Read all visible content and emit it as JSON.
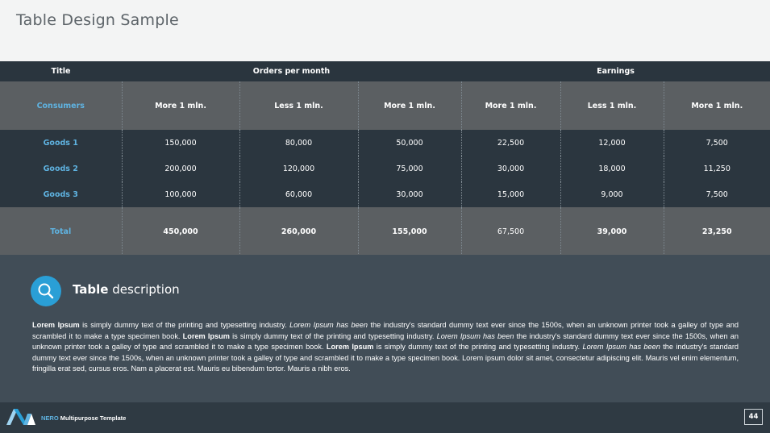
{
  "page": {
    "title": "Table Design Sample",
    "number": "44"
  },
  "table": {
    "group_headers": {
      "title": "Title",
      "orders": "Orders per month",
      "earnings": "Earnings"
    },
    "sub_headers": [
      "Consumers",
      "More 1 mln.",
      "Less 1 mln.",
      "More 1 mln.",
      "More 1 mln.",
      "Less 1 mln.",
      "More 1 mln."
    ],
    "rows": [
      {
        "label": "Goods 1",
        "values": [
          "150,000",
          "80,000",
          "50,000",
          "22,500",
          "12,000",
          "7,500"
        ]
      },
      {
        "label": "Goods 2",
        "values": [
          "200,000",
          "120,000",
          "75,000",
          "30,000",
          "18,000",
          "11,250"
        ]
      },
      {
        "label": "Goods 3",
        "values": [
          "100,000",
          "60,000",
          "30,000",
          "15,000",
          "9,000",
          "7,500"
        ]
      }
    ],
    "total": {
      "label": "Total",
      "values": [
        "450,000",
        "260,000",
        "155,000",
        "67,500",
        "39,000",
        "23,250"
      ]
    }
  },
  "description": {
    "heading_bold": "Table",
    "heading_rest": " description",
    "segments": [
      {
        "t": "Lorem Ipsum",
        "s": "b"
      },
      {
        "t": " is simply dummy text of the printing and typesetting industry. ",
        "s": ""
      },
      {
        "t": "Lorem Ipsum has been",
        "s": "i"
      },
      {
        "t": " the industry's standard dummy text ever since the 1500s, when an unknown printer took a galley of type and scrambled it to make a type specimen book. ",
        "s": ""
      },
      {
        "t": "Lorem Ipsum",
        "s": "b"
      },
      {
        "t": " is simply dummy text of the printing and typesetting industry. ",
        "s": ""
      },
      {
        "t": "Lorem Ipsum has been",
        "s": "i"
      },
      {
        "t": " the industry's standard dummy text ever since the 1500s, when an unknown printer took a galley of type and scrambled it to make a type specimen book. ",
        "s": ""
      },
      {
        "t": "Lorem Ipsum",
        "s": "b"
      },
      {
        "t": " is simply dummy text of the printing and typesetting industry. ",
        "s": ""
      },
      {
        "t": "Lorem Ipsum has been",
        "s": "i"
      },
      {
        "t": " the industry's standard dummy text ever since the 1500s, when an unknown printer took a galley of type and scrambled it to make a type specimen book. Lorem ipsum dolor sit amet, consectetur adipiscing elit. Mauris vel enim elementum, fringilla erat sed, cursus eros. Nam a placerat est. Mauris eu bibendum tortor. Mauris a nibh eros.",
        "s": ""
      }
    ]
  },
  "footer": {
    "brand": "NERO",
    "template": " Multipurpose Template"
  },
  "icons": {
    "search": "search-icon",
    "logo": "nero-logo-icon"
  },
  "colors": {
    "accent": "#2a9fd6",
    "header_dark": "#2a353e",
    "header_grey": "#5b5f62"
  }
}
